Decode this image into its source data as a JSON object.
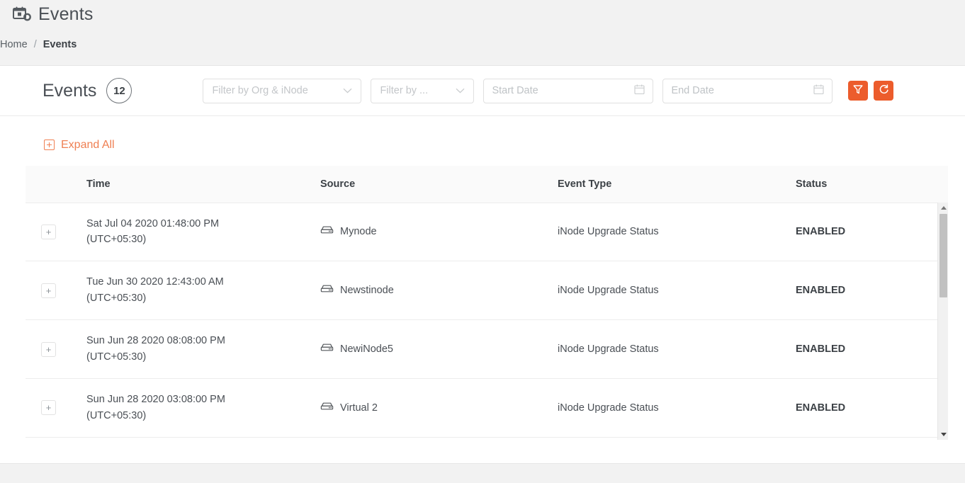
{
  "page": {
    "title": "Events",
    "header_icon": "calendar-gear-icon"
  },
  "breadcrumb": {
    "home": "Home",
    "separator": "/",
    "current": "Events"
  },
  "card": {
    "title": "Events",
    "count": "12"
  },
  "filters": {
    "org_inode": {
      "placeholder": "Filter by Org & iNode",
      "icon": "chevron-down-icon"
    },
    "event_type": {
      "placeholder": "Filter by ...",
      "icon": "chevron-down-icon"
    },
    "start_date": {
      "placeholder": "Start Date",
      "icon": "calendar-icon"
    },
    "end_date": {
      "placeholder": "End Date",
      "icon": "calendar-icon"
    },
    "apply_button": {
      "icon": "funnel-filter-icon",
      "color": "#ec5c2c"
    },
    "refresh_button": {
      "icon": "refresh-icon",
      "color": "#ec5c2c"
    }
  },
  "toolbar": {
    "expand_all": "Expand All",
    "expand_all_icon": "plus-square-icon",
    "accent_color": "#ef7f52"
  },
  "table": {
    "columns": [
      "",
      "Time",
      "Source",
      "Event Type",
      "Status"
    ],
    "expand_symbol": "+",
    "rows": [
      {
        "time": "Sat Jul 04 2020 01:48:00 PM",
        "timezone": "(UTC+05:30)",
        "source": "Mynode",
        "source_icon": "server-icon",
        "event_type": "iNode Upgrade Status",
        "status": "ENABLED"
      },
      {
        "time": "Tue Jun 30 2020 12:43:00 AM",
        "timezone": "(UTC+05:30)",
        "source": "Newstinode",
        "source_icon": "server-icon",
        "event_type": "iNode Upgrade Status",
        "status": "ENABLED"
      },
      {
        "time": "Sun Jun 28 2020 08:08:00 PM",
        "timezone": "(UTC+05:30)",
        "source": "NewiNode5",
        "source_icon": "server-icon",
        "event_type": "iNode Upgrade Status",
        "status": "ENABLED"
      },
      {
        "time": "Sun Jun 28 2020 03:08:00 PM",
        "timezone": "(UTC+05:30)",
        "source": "Virtual 2",
        "source_icon": "server-icon",
        "event_type": "iNode Upgrade Status",
        "status": "ENABLED"
      }
    ]
  },
  "scrollbar": {
    "up_icon": "triangle-up-icon",
    "down_icon": "triangle-down-icon"
  }
}
